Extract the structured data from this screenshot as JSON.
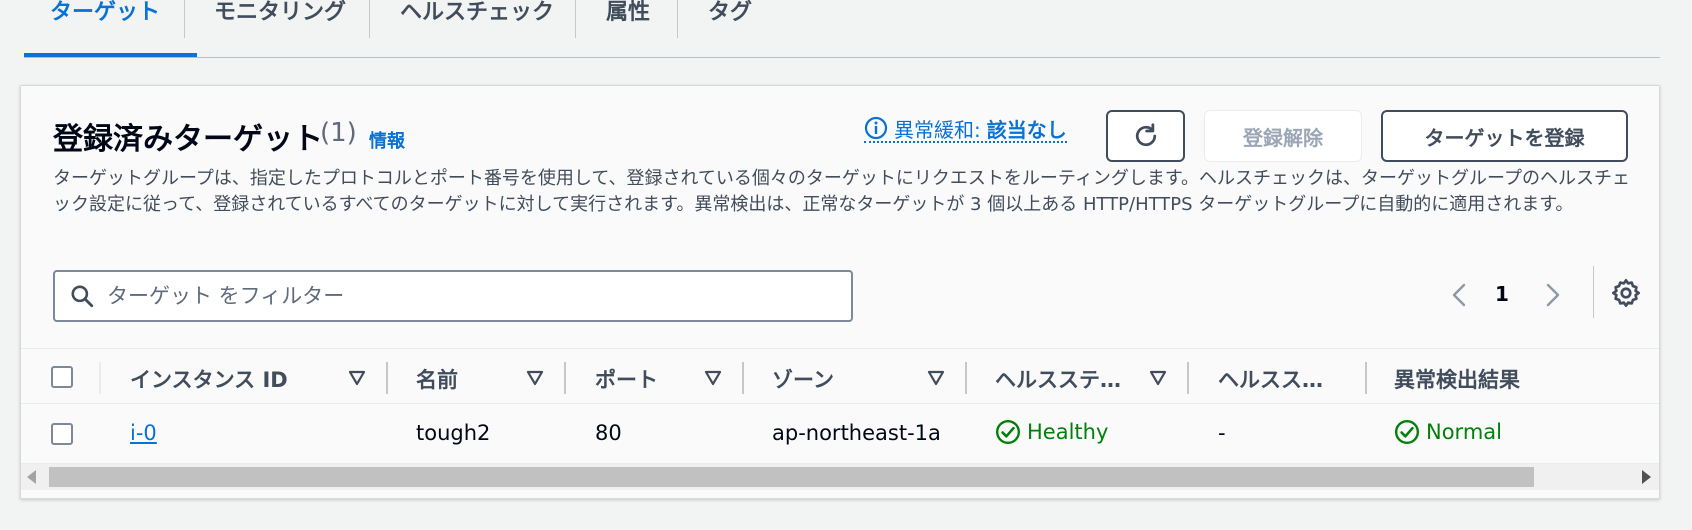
{
  "tabs": [
    {
      "label": "ターゲット",
      "active": true
    },
    {
      "label": "モニタリング",
      "active": false
    },
    {
      "label": "ヘルスチェック",
      "active": false
    },
    {
      "label": "属性",
      "active": false
    },
    {
      "label": "タグ",
      "active": false
    }
  ],
  "panel": {
    "title": "登録済みターゲット",
    "count": "(1)",
    "info_link": "情報",
    "anomaly_label": "異常緩和:",
    "anomaly_value": "該当なし",
    "deregister_label": "登録解除",
    "register_label": "ターゲットを登録",
    "description": "ターゲットグループは、指定したプロトコルとポート番号を使用して、登録されている個々のターゲットにリクエストをルーティングします。ヘルスチェックは、ターゲットグループのヘルスチェック設定に従って、登録されているすべてのターゲットに対して実行されます。異常検出は、正常なターゲットが 3 個以上ある HTTP/HTTPS ターゲットグループに自動的に適用されます。",
    "search_placeholder": "ターゲット をフィルター",
    "page_number": "1"
  },
  "table": {
    "columns": [
      "インスタンス ID",
      "名前",
      "ポート",
      "ゾーン",
      "ヘルスステ…",
      "ヘルスス…",
      "異常検出結果"
    ],
    "rows": [
      {
        "instance_id": "i-0",
        "name": "tough2",
        "port": "80",
        "zone": "ap-northeast-1a",
        "health_status": "Healthy",
        "health_details": "-",
        "anomaly_result": "Normal"
      }
    ]
  },
  "colors": {
    "accent": "#0972d3",
    "success": "#037f0c",
    "text": "#000716",
    "muted": "#414d5c"
  }
}
